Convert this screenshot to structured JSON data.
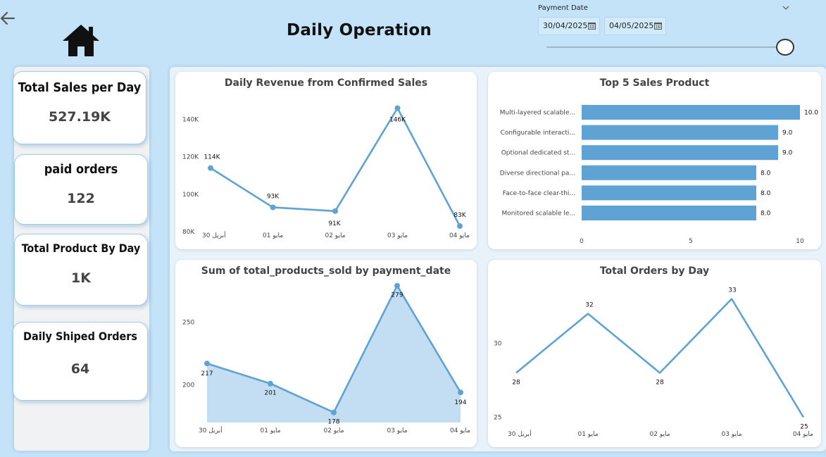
{
  "header": {
    "title": "Daily Operation",
    "back_icon": "back-arrow-icon",
    "home_icon": "home-icon"
  },
  "slicer": {
    "title": "Payment Date",
    "start": "30/04/2025",
    "end": "04/05/2025"
  },
  "kpis": [
    {
      "label": "Total Sales per Day",
      "value": "527.19K"
    },
    {
      "label": "paid orders",
      "value": "122"
    },
    {
      "label": "Total Product By Day",
      "value": "1K"
    },
    {
      "label": "Daily Shiped Orders",
      "value": "64"
    }
  ],
  "colors": {
    "background": "#c4e3f8",
    "series": "#5fa2d4",
    "area_fill": "#c0dcf1"
  },
  "chart_data": [
    {
      "type": "line",
      "title": "Daily Revenue from Confirmed Sales",
      "categories": [
        "30 أبريل",
        "01 مايو",
        "02 مايو",
        "03 مايو",
        "04 مايو"
      ],
      "values": [
        114,
        93,
        91,
        146,
        83
      ],
      "labels": [
        "114K",
        "93K",
        "91K",
        "146K",
        "83K"
      ],
      "yticks": [
        "80K",
        "100K",
        "120K",
        "140K"
      ],
      "ylim": [
        80,
        150
      ]
    },
    {
      "type": "bar",
      "title": "Top 5 Sales Product",
      "categories": [
        "Multi-layered scalable...",
        "Configurable interacti...",
        "Optional dedicated st...",
        "Diverse directional pa...",
        "Face-to-face clear-thi...",
        "Monitored scalable le..."
      ],
      "values": [
        10,
        9,
        9,
        8,
        8,
        8
      ],
      "labels": [
        "10.0",
        "9.0",
        "9.0",
        "8.0",
        "8.0",
        "8.0"
      ],
      "xticks": [
        "0",
        "5",
        "10"
      ],
      "xlim": [
        0,
        10
      ]
    },
    {
      "type": "area",
      "title": "Sum of total_products_sold by payment_date",
      "categories": [
        "30 أبريل",
        "01 مايو",
        "02 مايو",
        "03 مايو",
        "04 مايو"
      ],
      "values": [
        217,
        201,
        178,
        279,
        194
      ],
      "labels": [
        "217",
        "201",
        "178",
        "279",
        "194"
      ],
      "yticks": [
        "200",
        "250"
      ],
      "ylim": [
        170,
        285
      ]
    },
    {
      "type": "line",
      "title": "Total Orders by Day",
      "categories": [
        "30 أبريل",
        "01 مايو",
        "02 مايو",
        "03 مايو",
        "04 مايو"
      ],
      "values": [
        28,
        32,
        28,
        33,
        25
      ],
      "labels": [
        "28",
        "32",
        "28",
        "33",
        "25"
      ],
      "yticks": [
        "25",
        "30"
      ],
      "ylim": [
        24.5,
        34.5
      ]
    }
  ]
}
